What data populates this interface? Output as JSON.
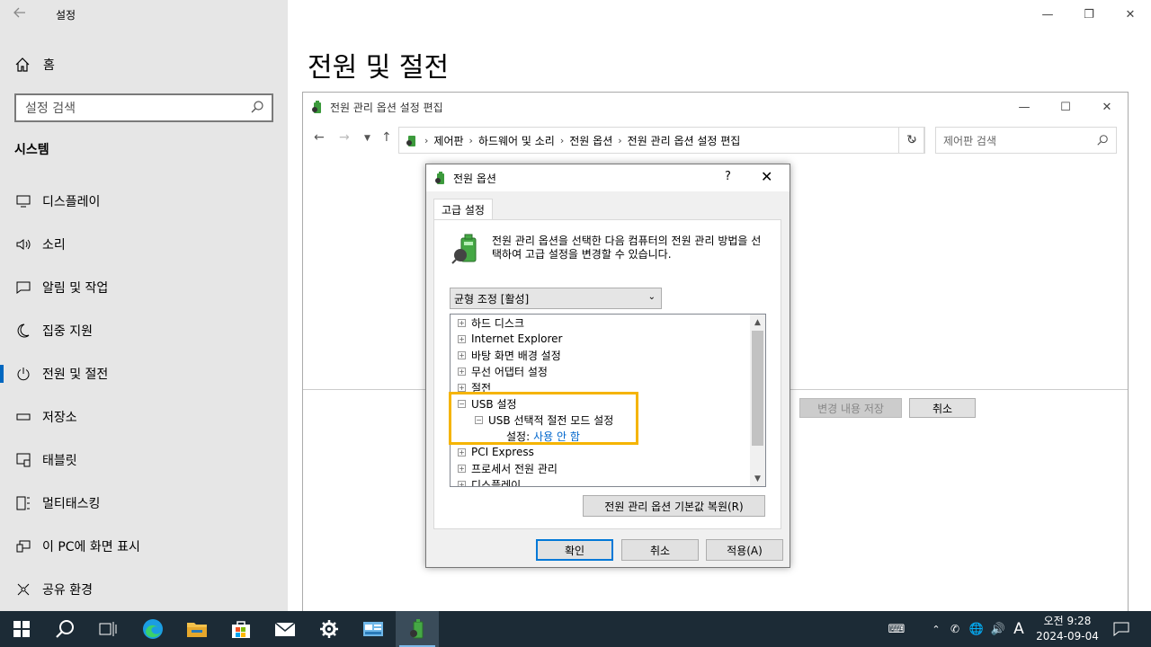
{
  "settings": {
    "window_title": "설정",
    "home_label": "홈",
    "search_placeholder": "설정 검색",
    "section": "시스템",
    "page_title": "전원 및 절전",
    "nav": [
      {
        "label": "디스플레이",
        "icon": "monitor-icon"
      },
      {
        "label": "소리",
        "icon": "speaker-icon"
      },
      {
        "label": "알림 및 작업",
        "icon": "notification-icon"
      },
      {
        "label": "집중 지원",
        "icon": "moon-icon"
      },
      {
        "label": "전원 및 절전",
        "icon": "power-icon",
        "active": true
      },
      {
        "label": "저장소",
        "icon": "storage-icon"
      },
      {
        "label": "태블릿",
        "icon": "tablet-icon"
      },
      {
        "label": "멀티태스킹",
        "icon": "multitask-icon"
      },
      {
        "label": "이 PC에 화면 표시",
        "icon": "project-icon"
      },
      {
        "label": "공유 환경",
        "icon": "share-icon"
      }
    ]
  },
  "control_panel": {
    "title": "전원 관리 옵션 설정 편집",
    "breadcrumb": [
      "제어판",
      "하드웨어 및 소리",
      "전원 옵션",
      "전원 관리 옵션 설정 편집"
    ],
    "search_placeholder": "제어판 검색",
    "save_label": "변경 내용 저장",
    "cancel_label": "취소"
  },
  "dialog": {
    "title": "전원 옵션",
    "help": "?",
    "tab": "고급 설정",
    "description": "전원 관리 옵션을 선택한 다음 컴퓨터의 전원 관리 방법을 선택하여 고급 설정을 변경할 수 있습니다.",
    "plan_selected": "균형 조정 [활성]",
    "tree": [
      {
        "label": "하드 디스크",
        "sign": "⊞",
        "indent": 0
      },
      {
        "label": "Internet Explorer",
        "sign": "⊞",
        "indent": 0
      },
      {
        "label": "바탕 화면 배경 설정",
        "sign": "⊞",
        "indent": 0
      },
      {
        "label": "무선 어댑터 설정",
        "sign": "⊞",
        "indent": 0
      },
      {
        "label": "절전",
        "sign": "⊞",
        "indent": 0
      },
      {
        "label": "USB 설정",
        "sign": "⊟",
        "indent": 0
      },
      {
        "label": "USB 선택적 절전 모드 설정",
        "sign": "⊟",
        "indent": 1
      },
      {
        "label": "설정:",
        "value": "사용 안 함",
        "indent": 2
      },
      {
        "label": "PCI Express",
        "sign": "⊞",
        "indent": 0
      },
      {
        "label": "프로세서 전원 관리",
        "sign": "⊞",
        "indent": 0
      },
      {
        "label": "디스플레이",
        "sign": "⊞",
        "indent": 0
      }
    ],
    "restore_label": "전원 관리 옵션 기본값 복원(R)",
    "ok_label": "확인",
    "cancel_label": "취소",
    "apply_label": "적용(A)"
  },
  "taskbar": {
    "clock_time": "오전 9:28",
    "clock_date": "2024-09-04",
    "ime": "A",
    "colors": {
      "bg": "#1c2b36",
      "accent": "#0078d7",
      "highlight": "#f5b400"
    }
  }
}
